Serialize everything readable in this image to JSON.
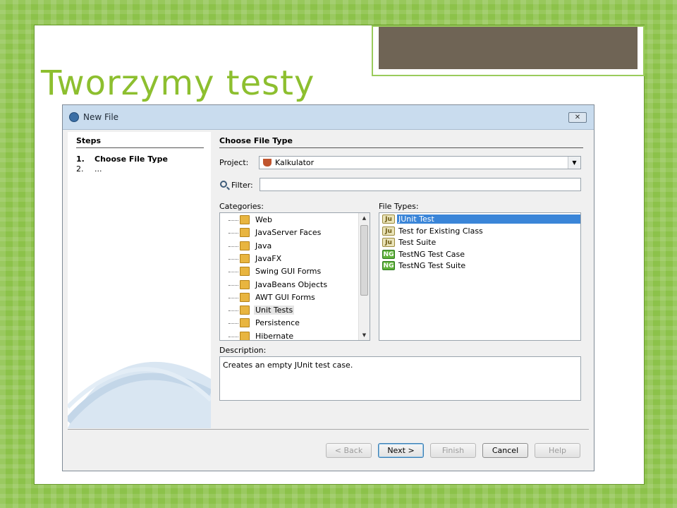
{
  "slide": {
    "title": "Tworzymy testy"
  },
  "dialog": {
    "title": "New File",
    "close_icon": "close-icon",
    "steps": {
      "heading": "Steps",
      "items": [
        {
          "num": "1.",
          "label": "Choose File Type"
        },
        {
          "num": "2.",
          "label": "..."
        }
      ]
    },
    "main": {
      "heading": "Choose File Type",
      "project_label": "Project:",
      "project_value": "Kalkulator",
      "filter_label": "Filter:",
      "filter_value": "",
      "categories_label": "Categories:",
      "categories": [
        "Web",
        "JavaServer Faces",
        "Java",
        "JavaFX",
        "Swing GUI Forms",
        "JavaBeans Objects",
        "AWT GUI Forms",
        "Unit Tests",
        "Persistence",
        "Hibernate"
      ],
      "selected_category": "Unit Tests",
      "file_types_label": "File Types:",
      "file_types": [
        {
          "icon": "junit-icon",
          "badge": "Ju",
          "label": "JUnit Test"
        },
        {
          "icon": "junit-icon",
          "badge": "Ju",
          "label": "Test for Existing Class"
        },
        {
          "icon": "junit-icon",
          "badge": "Ju",
          "label": "Test Suite"
        },
        {
          "icon": "testng-icon",
          "badge": "NG",
          "label": "TestNG Test Case"
        },
        {
          "icon": "testng-icon",
          "badge": "NG",
          "label": "TestNG Test Suite"
        }
      ],
      "selected_file_type": "JUnit Test",
      "description_label": "Description:",
      "description": "Creates an empty JUnit test case."
    },
    "buttons": {
      "back": "< Back",
      "next": "Next >",
      "finish": "Finish",
      "cancel": "Cancel",
      "help": "Help"
    }
  },
  "colors": {
    "title_green": "#8dbf2f",
    "selection_blue": "#3a85d8",
    "background_green": "#8cc24a"
  }
}
